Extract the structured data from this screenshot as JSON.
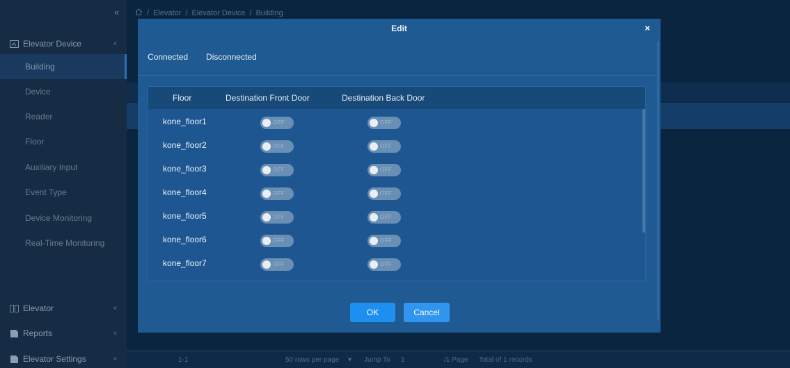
{
  "sidebar": {
    "collapse_icon": "«",
    "groups": [
      {
        "label": "Elevator Device",
        "icon": "elevator-device-icon",
        "chevron": "˄"
      },
      {
        "label": "Elevator",
        "icon": "elevator-icon",
        "chevron": "˅"
      },
      {
        "label": "Reports",
        "icon": "reports-icon",
        "chevron": "˅"
      },
      {
        "label": "Elevator Settings",
        "icon": "settings-icon",
        "chevron": "˅"
      }
    ],
    "items": [
      {
        "label": "Building",
        "active": true
      },
      {
        "label": "Device"
      },
      {
        "label": "Reader"
      },
      {
        "label": "Floor"
      },
      {
        "label": "Auxiliary Input"
      },
      {
        "label": "Event Type"
      },
      {
        "label": "Device Monitoring"
      },
      {
        "label": "Real-Time Monitoring"
      }
    ]
  },
  "breadcrumb": {
    "home_icon": "home-icon",
    "separator": "/",
    "items": [
      "Elevator",
      "Elevator Device",
      "Building"
    ]
  },
  "footer": {
    "range": "1-1",
    "rows_per_page": "50 rows per page",
    "jump_label": "Jump To",
    "jump_value": "1",
    "page_total": "/1 Page",
    "records": "Total of 1 records"
  },
  "modal": {
    "title": "Edit",
    "close_label": "×",
    "tabs": [
      "Connected",
      "Disconnected"
    ],
    "columns": [
      "Floor",
      "Destination Front Door",
      "Destination Back Door"
    ],
    "toggle_off_label": "OFF",
    "rows": [
      {
        "floor": "kone_floor1",
        "front": false,
        "back": false
      },
      {
        "floor": "kone_floor2",
        "front": false,
        "back": false
      },
      {
        "floor": "kone_floor3",
        "front": false,
        "back": false
      },
      {
        "floor": "kone_floor4",
        "front": false,
        "back": false
      },
      {
        "floor": "kone_floor5",
        "front": false,
        "back": false
      },
      {
        "floor": "kone_floor6",
        "front": false,
        "back": false
      },
      {
        "floor": "kone_floor7",
        "front": false,
        "back": false
      },
      {
        "floor": "",
        "front": false,
        "back": false
      }
    ],
    "ok_label": "OK",
    "cancel_label": "Cancel"
  },
  "colors": {
    "modal_bg": "#1f5a92",
    "primary_button": "#1d8ff0",
    "toggle_off": "#6a8fb4"
  }
}
